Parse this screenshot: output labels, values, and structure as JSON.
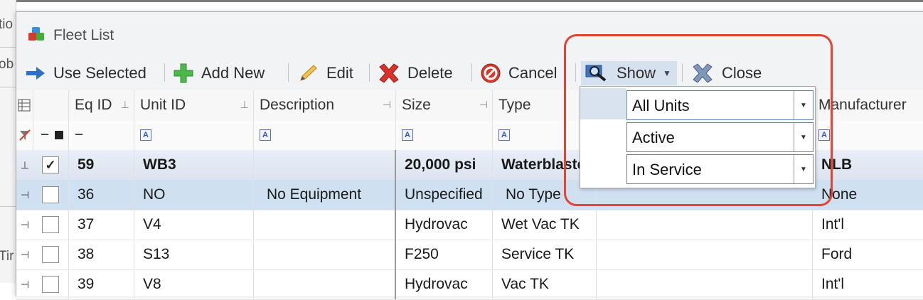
{
  "window": {
    "title": "Fleet List"
  },
  "background": {
    "fragments": [
      "tio",
      "ob",
      "Tir"
    ]
  },
  "toolbar": {
    "use_selected": "Use Selected",
    "add_new": "Add New",
    "edit": "Edit",
    "delete": "Delete",
    "cancel": "Cancel",
    "show": "Show",
    "close": "Close"
  },
  "grid": {
    "headers": {
      "eq_id": "Eq ID",
      "unit_id": "Unit ID",
      "description": "Description",
      "size": "Size",
      "type": "Type",
      "manufacturer": "Manufacturer"
    },
    "filter_symbols": {
      "minus": "−",
      "filter": "A"
    },
    "rows": [
      {
        "eq_id": "59",
        "unit_id": "WB3",
        "description": "",
        "size": "20,000 psi",
        "type": "Waterblaster",
        "manufacturer": "NLB",
        "checked": true
      },
      {
        "eq_id": "36",
        "unit_id": "NO",
        "description": "No Equipment",
        "size": "Unspecified",
        "type": "No Type",
        "manufacturer": "None",
        "checked": false
      },
      {
        "eq_id": "37",
        "unit_id": "V4",
        "description": "",
        "size": "Hydrovac",
        "type": "Wet Vac TK",
        "manufacturer": "Int'l",
        "checked": false
      },
      {
        "eq_id": "38",
        "unit_id": "S13",
        "description": "",
        "size": "F250",
        "type": "Service TK",
        "manufacturer": "Ford",
        "checked": false
      },
      {
        "eq_id": "39",
        "unit_id": "V8",
        "description": "",
        "size": "Hydrovac",
        "type": "Vac TK",
        "manufacturer": "Int'l",
        "checked": false
      }
    ]
  },
  "show_dropdown": {
    "filters": [
      {
        "label": "All Units",
        "selected": true
      },
      {
        "label": "Active",
        "selected": false
      },
      {
        "label": "In Service",
        "selected": false
      }
    ]
  },
  "colors": {
    "highlight": "#e4432f",
    "selected_row": "#dbe4f0",
    "focused_row": "#cfe0f1"
  }
}
